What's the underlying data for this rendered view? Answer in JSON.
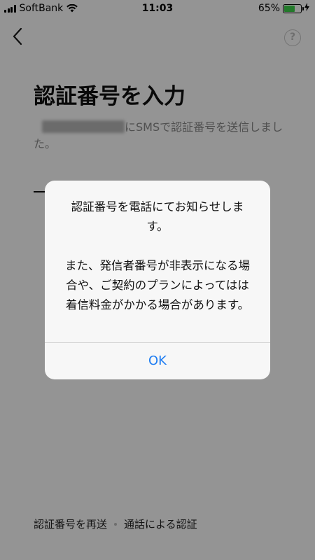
{
  "status_bar": {
    "carrier": "SoftBank",
    "time": "11:03",
    "battery_percent": "65%",
    "battery_level": 0.65,
    "battery_color": "#3dd34a"
  },
  "nav": {
    "back_icon": "chevron-left-icon",
    "help_label": "?"
  },
  "main": {
    "title": "認証番号を入力",
    "description_suffix": "にSMSで認証番号を送信しました。"
  },
  "footer": {
    "resend_label": "認証番号を再送",
    "call_label": "通話による認証"
  },
  "alert": {
    "message": "認証番号を電話にてお知らせします。\n\nまた、発信者番号が非表示になる場合や、ご契約のプランによってはは着信料金がかかる場合があります。",
    "ok_label": "OK",
    "ok_color": "#1d7cf2"
  }
}
